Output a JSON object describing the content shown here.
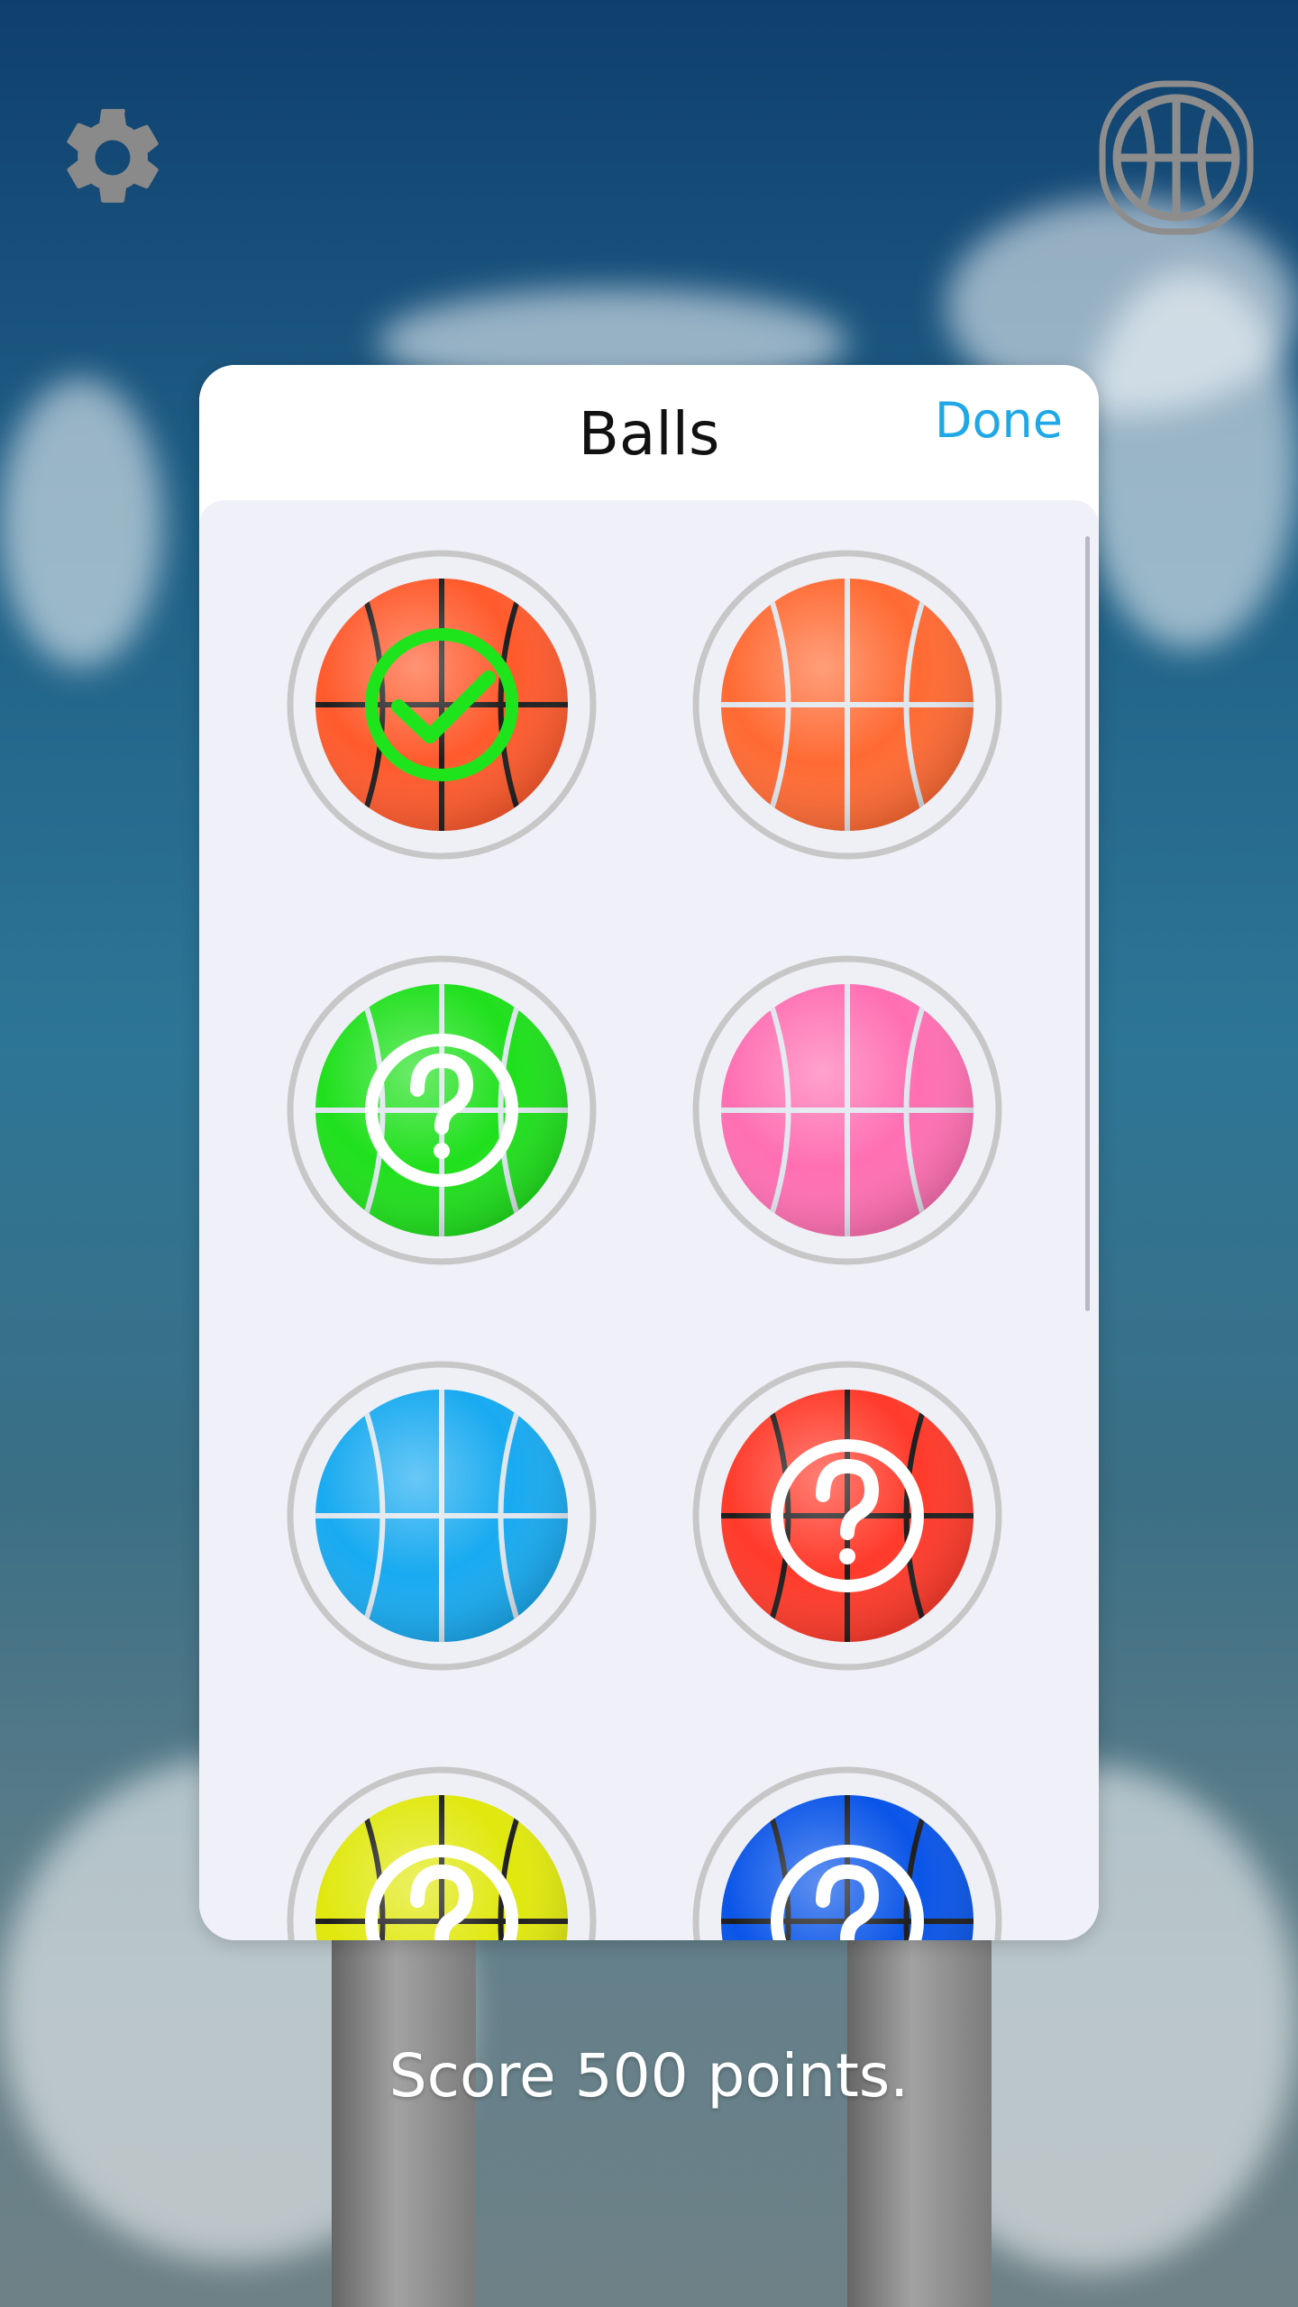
{
  "panel": {
    "title": "Balls",
    "done_label": "Done"
  },
  "caption": "Score 500 points.",
  "balls": [
    {
      "color": "#ff5a2c",
      "line_color": "#1e1e1e",
      "state": "selected"
    },
    {
      "color": "#ff6a33",
      "line_color": "#dfe6ee",
      "state": "unlocked"
    },
    {
      "color": "#1fe01c",
      "line_color": "#dfe6ee",
      "state": "locked"
    },
    {
      "color": "#ff6fb2",
      "line_color": "#dfe6ee",
      "state": "unlocked"
    },
    {
      "color": "#18aaf0",
      "line_color": "#dfe6ee",
      "state": "unlocked"
    },
    {
      "color": "#ff3a2a",
      "line_color": "#1e1e1e",
      "state": "locked"
    },
    {
      "color": "#e0e80e",
      "line_color": "#1e1e1e",
      "state": "locked"
    },
    {
      "color": "#0a55e8",
      "line_color": "#1e1e1e",
      "state": "locked"
    }
  ],
  "colors": {
    "accent": "#20a8e6",
    "selected_check": "#1ee51b",
    "ring": "#c7c7c7"
  },
  "icons": {
    "settings": "gear-icon",
    "ball_picker": "basketball-icon",
    "selected": "check-icon",
    "locked": "question-icon"
  }
}
